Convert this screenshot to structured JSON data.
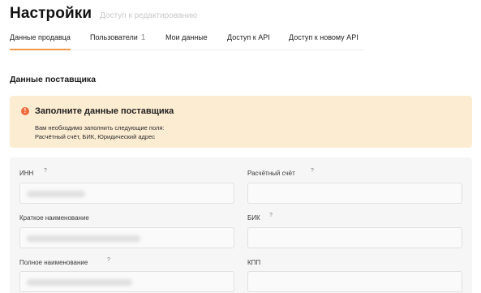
{
  "header": {
    "title": "Настройки",
    "subtitle": "Доступ к редактированию"
  },
  "tabs": [
    {
      "label": "Данные продавца",
      "active": true
    },
    {
      "label": "Пользователи",
      "count": "1"
    },
    {
      "label": "Мои данные"
    },
    {
      "label": "Доступ к API"
    },
    {
      "label": "Доступ к новому API"
    }
  ],
  "section": {
    "title": "Данные поставщика"
  },
  "alert": {
    "icon": "exclamation-icon",
    "title": "Заполните данные поставщика",
    "line1": "Вам необходимо заполнить следующие поля:",
    "line2": "Расчётный счёт, БИК, Юридический адрес",
    "background_color": "#fcecd2",
    "icon_color": "#ef6a3b"
  },
  "form": {
    "fields": [
      {
        "label": "ИНН",
        "has_help": true,
        "value_obscured": true
      },
      {
        "label": "Расчётный счёт",
        "has_help": true,
        "value": ""
      },
      {
        "label": "Краткое наименование",
        "has_help": false,
        "value_obscured": true
      },
      {
        "label": "БИК",
        "has_help": true,
        "value": ""
      },
      {
        "label": "Полное наименование",
        "has_help": true,
        "value_obscured": true
      },
      {
        "label": "КПП",
        "has_help": false,
        "value": ""
      }
    ],
    "help_symbol": "?"
  },
  "colors": {
    "tab_active_underline": "#f2994a",
    "subtitle": "#c9c9c9"
  }
}
